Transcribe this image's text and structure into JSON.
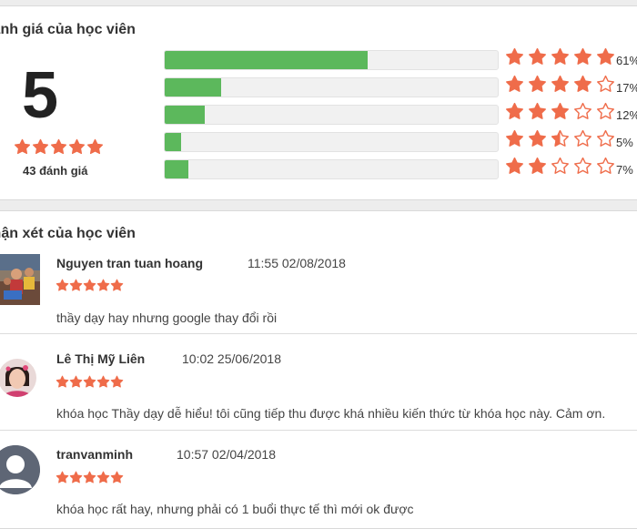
{
  "ratings_section": {
    "title": "Đánh giá của học viên",
    "average": "5",
    "average_stars": 5,
    "count_label": "43 đánh giá",
    "star_color": "#ef6c4a",
    "bar_color": "#5cb85c",
    "rows": [
      {
        "stars": 5,
        "fill": 0.61,
        "percent": "61%"
      },
      {
        "stars": 4,
        "fill": 0.17,
        "percent": "17%"
      },
      {
        "stars": 3,
        "fill": 0.12,
        "percent": "12%"
      },
      {
        "stars": 2.5,
        "fill": 0.05,
        "percent": "5%"
      },
      {
        "stars": 2,
        "fill": 0.07,
        "percent": "7%"
      }
    ]
  },
  "reviews_section": {
    "title": "Nhận xét của học viên",
    "reviews": [
      {
        "name": "Nguyen tran tuan hoang",
        "time": "11:55 02/08/2018",
        "stars": 5,
        "text": "thầy dạy hay nhưng google thay đổi rồi",
        "avatar": "photo-avatar"
      },
      {
        "name": "Lê Thị Mỹ Liên",
        "time": "10:02 25/06/2018",
        "stars": 5,
        "text": "khóa học Thầy dạy dễ hiểu! tôi cũng tiếp thu được khá nhiều kiến thức từ khóa học này. Cảm ơn.",
        "avatar": "photo-avatar"
      },
      {
        "name": "tranvanminh",
        "time": "10:57 02/04/2018",
        "stars": 5,
        "text": "khóa học rất hay, nhưng phải có 1 buổi thực tế thì mới ok được",
        "avatar": "default-user-avatar"
      }
    ]
  }
}
